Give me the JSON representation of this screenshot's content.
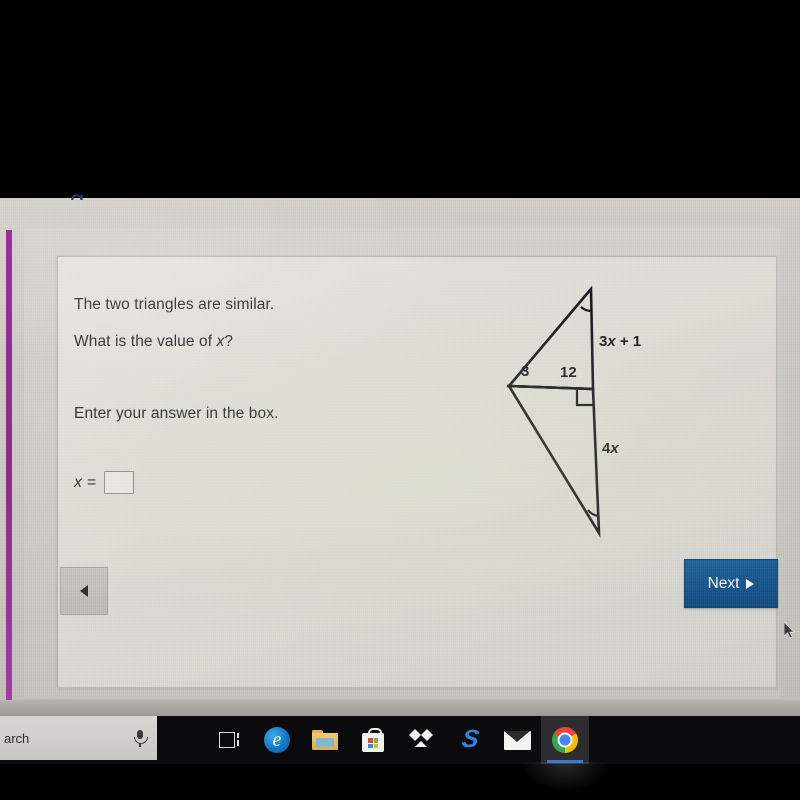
{
  "question": {
    "line1": "The two triangles are similar.",
    "line2_pre": "What is the value of ",
    "line2_var": "x",
    "line2_post": "?",
    "line3": "Enter your answer in the box.",
    "answer_label": "x",
    "answer_equals": "=",
    "answer_value": "",
    "answer_placeholder": ""
  },
  "figure": {
    "label_hypotenuse_top": "3x + 1",
    "label_3x1_num": "3",
    "label_3x1_var": "x",
    "label_3x1_plus": " + 1",
    "label_vertical_bottom": "4x",
    "label_4x_num": "4",
    "label_4x_var": "x",
    "label_small_left": "3",
    "label_small_right": "12",
    "stroke_color": "#1b1c1e"
  },
  "navigation": {
    "back_label": "",
    "next_label": "Next",
    "next_arrow": "▶",
    "next_bg": "#1b5487"
  },
  "page_chrome": {
    "accent_bar_color": "#9b2f9b",
    "cut_glyph": "g"
  },
  "taskbar": {
    "search_text": "arch",
    "search_placeholder": "Search",
    "mic_icon": "microphone-icon",
    "items": [
      {
        "name": "task-view",
        "label": "Task View"
      },
      {
        "name": "edge",
        "label": "Microsoft Edge",
        "glyph": "e"
      },
      {
        "name": "file-explorer",
        "label": "File Explorer"
      },
      {
        "name": "microsoft-store",
        "label": "Microsoft Store"
      },
      {
        "name": "dropbox",
        "label": "Dropbox"
      },
      {
        "name": "bolt-app",
        "label": "S",
        "glyph": "S"
      },
      {
        "name": "mail",
        "label": "Mail"
      },
      {
        "name": "chrome",
        "label": "Google Chrome",
        "active": true
      }
    ]
  }
}
